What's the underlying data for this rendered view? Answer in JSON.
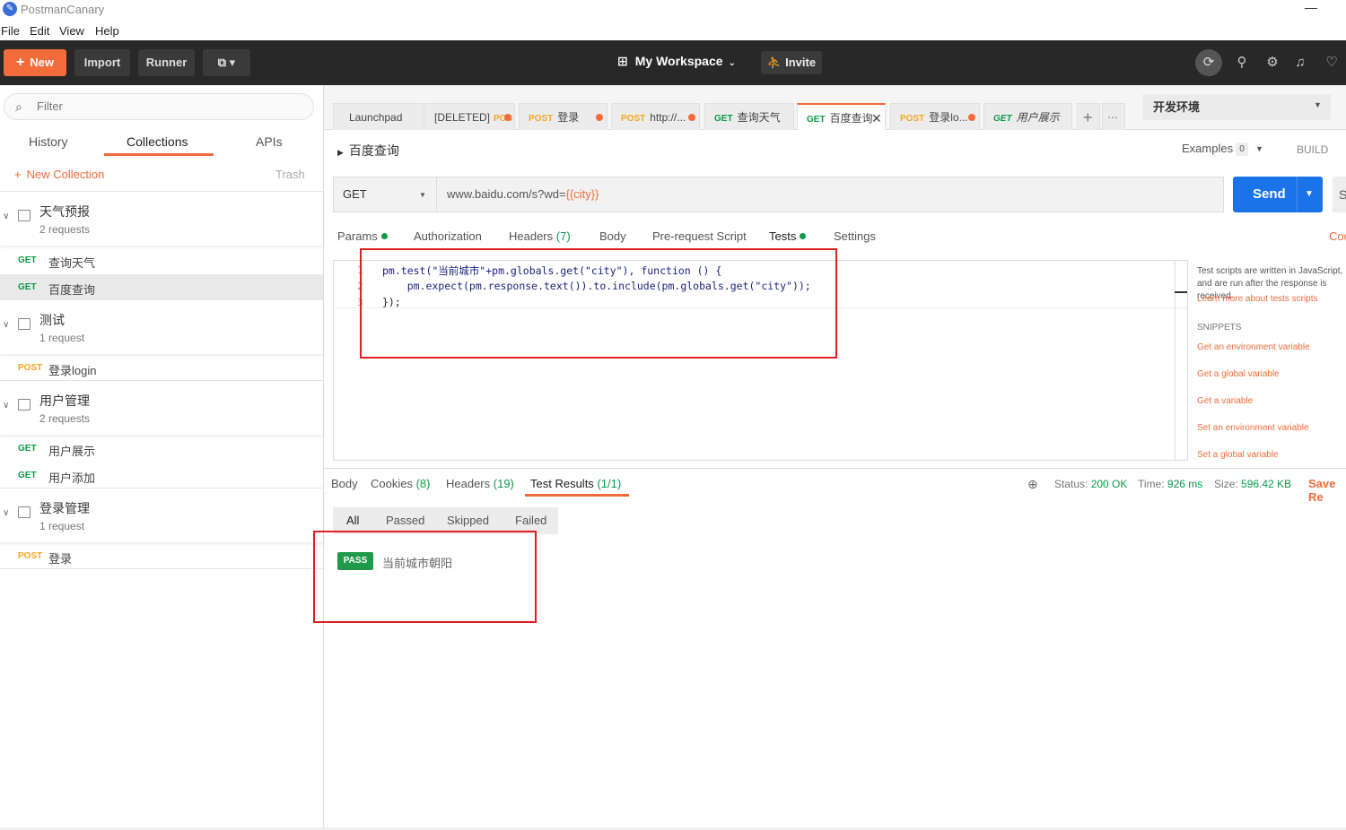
{
  "app": {
    "title": "PostmanCanary"
  },
  "menu": [
    "File",
    "Edit",
    "View",
    "Help"
  ],
  "toolbar": {
    "new_label": "New",
    "import_label": "Import",
    "runner_label": "Runner",
    "workspace": "My Workspace",
    "invite_label": "Invite"
  },
  "sidebar": {
    "filter_placeholder": "Filter",
    "tabs": [
      "History",
      "Collections",
      "APIs"
    ],
    "active_tab": "Collections",
    "new_collection": "New Collection",
    "trash": "Trash",
    "collections": [
      {
        "name": "天气预报",
        "count": "2 requests"
      },
      {
        "name": "测试",
        "count": "1 request"
      },
      {
        "name": "用户管理",
        "count": "2 requests"
      },
      {
        "name": "登录管理",
        "count": "1 request"
      }
    ],
    "requests": [
      {
        "method": "GET",
        "name": "查询天气"
      },
      {
        "method": "GET",
        "name": "百度查询"
      },
      {
        "method": "POST",
        "name": "登录login"
      },
      {
        "method": "GET",
        "name": "用户展示"
      },
      {
        "method": "GET",
        "name": "用户添加"
      },
      {
        "method": "POST",
        "name": "登录"
      }
    ]
  },
  "tabs": [
    {
      "method": "",
      "label": "Launchpad"
    },
    {
      "method": "",
      "label": "[DELETED]",
      "suffix": "POS"
    },
    {
      "method": "POST",
      "label": "登录"
    },
    {
      "method": "POST",
      "label": "http://..."
    },
    {
      "method": "GET",
      "label": "查询天气"
    },
    {
      "method": "GET",
      "label": "百度查询"
    },
    {
      "method": "POST",
      "label": "登录lo..."
    },
    {
      "method": "GET",
      "label": "用户展示"
    }
  ],
  "environment": "开发环境",
  "request": {
    "title": "百度查询",
    "examples_label": "Examples",
    "examples_count": "0",
    "build": "BUILD",
    "method": "GET",
    "url_prefix": "www.baidu.com/s?wd=",
    "url_var": "{{city}}",
    "send": "Send",
    "save_partial": "S",
    "tabs": {
      "params": "Params",
      "authorization": "Authorization",
      "headers": "Headers",
      "headers_count": "(7)",
      "body": "Body",
      "prerequest": "Pre-request Script",
      "tests": "Tests",
      "settings": "Settings",
      "code": "Coo"
    }
  },
  "editor": {
    "lines": [
      "pm.test(\"当前城市\"+pm.globals.get(\"city\"), function () {",
      "    pm.expect(pm.response.text()).to.include(pm.globals.get(\"city\"));",
      "});"
    ],
    "line_numbers": [
      "1",
      "2",
      "3"
    ]
  },
  "snippets": {
    "help": "Test scripts are written in JavaScript, and are run after the response is received.",
    "learn": "Learn more about tests scripts",
    "heading": "SNIPPETS",
    "items": [
      "Get an environment variable",
      "Get a global variable",
      "Get a variable",
      "Set an environment variable",
      "Set a global variable"
    ]
  },
  "response": {
    "tabs": {
      "body": "Body",
      "cookies": "Cookies",
      "cookies_count": "(8)",
      "headers": "Headers",
      "headers_count": "(19)",
      "test_results": "Test Results",
      "test_results_count": "(1/1)"
    },
    "status_label": "Status:",
    "status_value": "200 OK",
    "time_label": "Time:",
    "time_value": "926 ms",
    "size_label": "Size:",
    "size_value": "596.42 KB",
    "save_response": "Save Re",
    "filters": [
      "All",
      "Passed",
      "Skipped",
      "Failed"
    ],
    "result_badge": "PASS",
    "result_text": "当前城市朝阳"
  }
}
